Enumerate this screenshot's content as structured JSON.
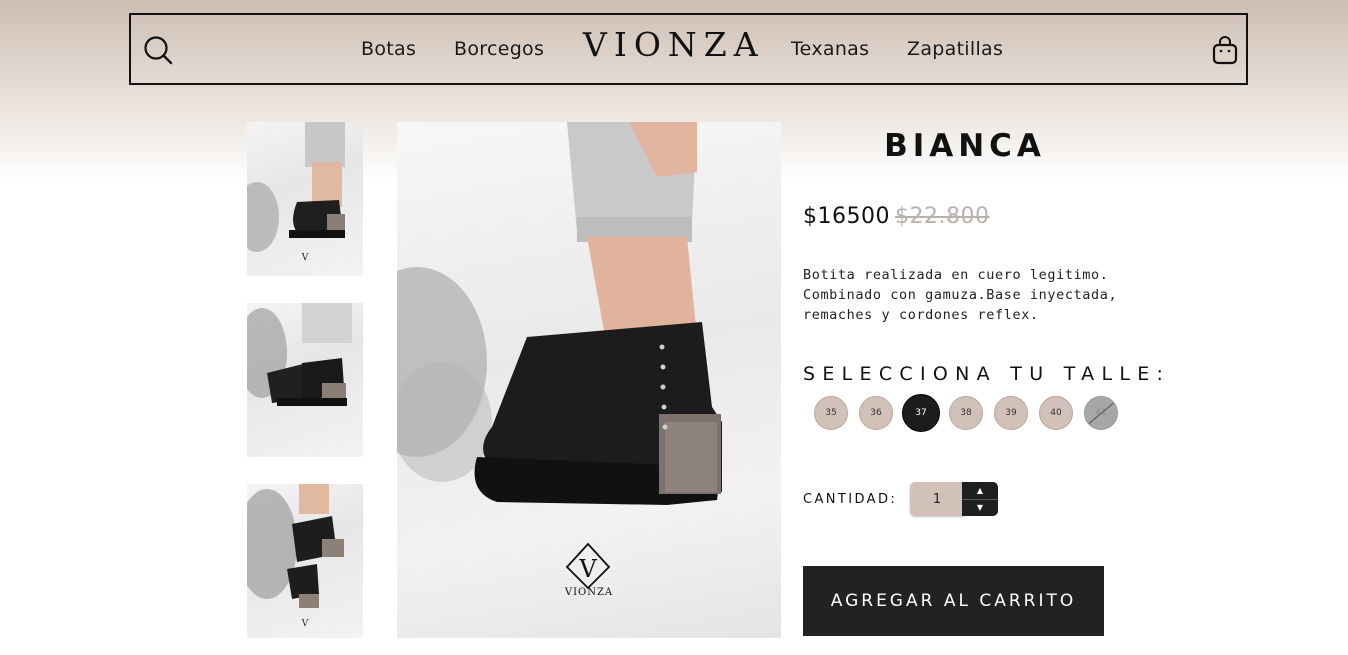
{
  "nav": {
    "links": [
      "Botas",
      "Borcegos",
      "Texanas",
      "Zapatillas"
    ],
    "logo": "VIONZA",
    "search_icon": "search-icon",
    "cart_icon": "shopping-bag-icon"
  },
  "gallery": {
    "watermark_logo": "VIONZA"
  },
  "product": {
    "title": "BIANCA",
    "price": "$16500",
    "old_price": "$22.800",
    "description_lines": [
      "Botita realizada en cuero legitimo.",
      "Combinado con gamuza.Base inyectada,",
      "remaches y cordones reflex."
    ]
  },
  "sizes": {
    "label": "SELECCIONA TU TALLE:",
    "options": [
      "35",
      "36",
      "37",
      "38",
      "39",
      "40",
      "41"
    ],
    "selected": "37",
    "unavailable": [
      "41"
    ]
  },
  "quantity": {
    "label": "CANTIDAD:",
    "value": "1"
  },
  "cart_button": {
    "label": "AGREGAR AL CARRITO"
  },
  "colors": {
    "accent_tan": "#d2c1b8",
    "dark": "#222222"
  }
}
